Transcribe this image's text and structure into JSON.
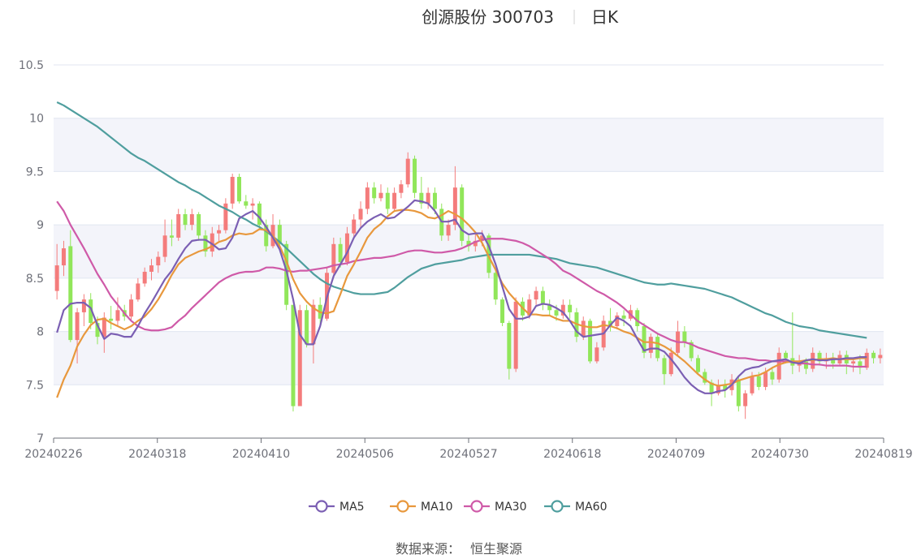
{
  "header": {
    "title": "创源股份 300703",
    "period": "日K"
  },
  "source": {
    "label": "数据来源：",
    "name": "恒生聚源"
  },
  "colors": {
    "up": "#f47c7c",
    "down": "#91e65a",
    "ma5": "#7b5fb3",
    "ma10": "#e8983d",
    "ma30": "#cf5aa8",
    "ma60": "#4f9e9e",
    "band": "#f3f4fa",
    "grid": "#e0e6f1",
    "axis": "#6e7079"
  },
  "chart_data": {
    "type": "candlestick",
    "y_axis": {
      "min": 7,
      "max": 10.5,
      "ticks": [
        "7",
        "7.5",
        "8",
        "8.5",
        "9",
        "9.5",
        "10",
        "10.5"
      ]
    },
    "x_axis": {
      "labels": [
        "20240226",
        "20240318",
        "20240410",
        "20240506",
        "20240527",
        "20240618",
        "20240709",
        "20240730",
        "20240819"
      ]
    },
    "legend": [
      {
        "key": "ma5",
        "label": "MA5"
      },
      {
        "key": "ma10",
        "label": "MA10"
      },
      {
        "key": "ma30",
        "label": "MA30"
      },
      {
        "key": "ma60",
        "label": "MA60"
      }
    ],
    "candles": [
      [
        8.38,
        8.62,
        8.3,
        8.82
      ],
      [
        8.62,
        8.78,
        8.52,
        8.85
      ],
      [
        8.8,
        7.92,
        7.9,
        8.95
      ],
      [
        7.92,
        8.18,
        7.7,
        8.22
      ],
      [
        8.18,
        8.3,
        8.05,
        8.35
      ],
      [
        8.3,
        8.08,
        8.02,
        8.36
      ],
      [
        8.08,
        7.95,
        7.88,
        8.14
      ],
      [
        7.95,
        8.13,
        7.8,
        8.18
      ],
      [
        8.12,
        8.1,
        8.02,
        8.24
      ],
      [
        8.1,
        8.2,
        8.05,
        8.32
      ],
      [
        8.2,
        8.14,
        8.1,
        8.25
      ],
      [
        8.14,
        8.3,
        8.1,
        8.35
      ],
      [
        8.3,
        8.45,
        8.28,
        8.5
      ],
      [
        8.45,
        8.56,
        8.42,
        8.6
      ],
      [
        8.56,
        8.62,
        8.48,
        8.68
      ],
      [
        8.62,
        8.7,
        8.55,
        8.75
      ],
      [
        8.7,
        8.9,
        8.65,
        9.05
      ],
      [
        8.9,
        8.88,
        8.8,
        9.05
      ],
      [
        8.88,
        9.1,
        8.85,
        9.15
      ],
      [
        9.1,
        9.0,
        8.95,
        9.15
      ],
      [
        9.0,
        9.1,
        8.95,
        9.15
      ],
      [
        9.1,
        8.9,
        8.85,
        9.12
      ],
      [
        8.9,
        8.75,
        8.7,
        8.95
      ],
      [
        8.75,
        8.92,
        8.7,
        8.98
      ],
      [
        8.92,
        8.95,
        8.85,
        9.0
      ],
      [
        8.95,
        9.2,
        8.92,
        9.25
      ],
      [
        9.2,
        9.45,
        9.15,
        9.48
      ],
      [
        9.45,
        9.22,
        9.2,
        9.48
      ],
      [
        9.22,
        9.18,
        9.15,
        9.28
      ],
      [
        9.18,
        9.2,
        9.05,
        9.25
      ],
      [
        9.2,
        9.0,
        8.95,
        9.22
      ],
      [
        9.0,
        8.8,
        8.75,
        9.05
      ],
      [
        8.8,
        9.0,
        8.78,
        9.1
      ],
      [
        9.0,
        8.82,
        8.78,
        9.05
      ],
      [
        8.82,
        8.25,
        8.2,
        8.85
      ],
      [
        8.25,
        7.3,
        7.25,
        8.2
      ],
      [
        7.3,
        8.2,
        7.32,
        8.25
      ],
      [
        8.2,
        7.88,
        7.85,
        8.25
      ],
      [
        7.88,
        8.25,
        7.7,
        8.3
      ],
      [
        8.25,
        8.12,
        8.05,
        8.32
      ],
      [
        8.12,
        8.55,
        8.1,
        8.6
      ],
      [
        8.55,
        8.82,
        8.5,
        8.88
      ],
      [
        8.82,
        8.65,
        8.6,
        8.88
      ],
      [
        8.65,
        8.92,
        8.62,
        8.98
      ],
      [
        8.92,
        9.05,
        8.88,
        9.1
      ],
      [
        9.05,
        9.15,
        8.98,
        9.22
      ],
      [
        9.15,
        9.35,
        9.1,
        9.4
      ],
      [
        9.35,
        9.25,
        9.2,
        9.4
      ],
      [
        9.25,
        9.3,
        9.22,
        9.38
      ],
      [
        9.3,
        9.15,
        9.1,
        9.35
      ],
      [
        9.15,
        9.3,
        9.12,
        9.35
      ],
      [
        9.3,
        9.38,
        9.25,
        9.42
      ],
      [
        9.38,
        9.62,
        9.35,
        9.68
      ],
      [
        9.62,
        9.3,
        9.25,
        9.65
      ],
      [
        9.3,
        9.2,
        9.15,
        9.45
      ],
      [
        9.2,
        9.3,
        9.15,
        9.35
      ],
      [
        9.3,
        9.15,
        9.1,
        9.35
      ],
      [
        9.15,
        8.9,
        8.85,
        9.2
      ],
      [
        8.9,
        9.0,
        8.85,
        9.05
      ],
      [
        9.0,
        9.35,
        8.95,
        9.55
      ],
      [
        9.35,
        8.85,
        8.8,
        9.38
      ],
      [
        8.85,
        8.8,
        8.75,
        8.9
      ],
      [
        8.8,
        8.85,
        8.75,
        8.92
      ],
      [
        8.85,
        8.9,
        8.8,
        8.95
      ],
      [
        8.9,
        8.55,
        8.5,
        8.92
      ],
      [
        8.55,
        8.3,
        8.25,
        8.58
      ],
      [
        8.3,
        8.08,
        8.05,
        8.32
      ],
      [
        8.08,
        7.65,
        7.55,
        8.1
      ],
      [
        7.65,
        8.28,
        7.62,
        8.32
      ],
      [
        8.28,
        8.15,
        8.1,
        8.32
      ],
      [
        8.15,
        8.3,
        8.12,
        8.35
      ],
      [
        8.3,
        8.38,
        8.25,
        8.42
      ],
      [
        8.38,
        8.25,
        8.2,
        8.42
      ],
      [
        8.25,
        8.2,
        8.15,
        8.3
      ],
      [
        8.2,
        8.15,
        8.1,
        8.25
      ],
      [
        8.15,
        8.25,
        8.12,
        8.3
      ],
      [
        8.25,
        8.18,
        8.12,
        8.3
      ],
      [
        8.18,
        7.95,
        7.9,
        8.22
      ],
      [
        7.95,
        8.1,
        7.92,
        8.14
      ],
      [
        8.1,
        7.72,
        7.7,
        8.12
      ],
      [
        7.72,
        7.85,
        7.7,
        7.9
      ],
      [
        7.85,
        8.1,
        7.82,
        8.15
      ],
      [
        8.1,
        8.05,
        8.0,
        8.22
      ],
      [
        8.05,
        8.15,
        8.02,
        8.18
      ],
      [
        8.15,
        8.12,
        8.05,
        8.2
      ],
      [
        8.12,
        8.2,
        8.1,
        8.25
      ],
      [
        8.2,
        8.05,
        8.0,
        8.22
      ],
      [
        8.05,
        7.8,
        7.75,
        8.08
      ],
      [
        7.8,
        7.95,
        7.75,
        7.98
      ],
      [
        7.95,
        7.75,
        7.72,
        7.98
      ],
      [
        7.75,
        7.6,
        7.5,
        7.78
      ],
      [
        7.6,
        7.8,
        7.58,
        7.85
      ],
      [
        7.8,
        8.0,
        7.78,
        8.1
      ],
      [
        8.0,
        7.9,
        7.85,
        8.05
      ],
      [
        7.9,
        7.75,
        7.72,
        7.92
      ],
      [
        7.75,
        7.62,
        7.6,
        7.78
      ],
      [
        7.62,
        7.52,
        7.5,
        7.65
      ],
      [
        7.52,
        7.42,
        7.3,
        7.55
      ],
      [
        7.42,
        7.5,
        7.4,
        7.55
      ],
      [
        7.5,
        7.45,
        7.38,
        7.55
      ],
      [
        7.45,
        7.55,
        7.4,
        7.6
      ],
      [
        7.55,
        7.3,
        7.25,
        7.58
      ],
      [
        7.3,
        7.42,
        7.18,
        7.45
      ],
      [
        7.42,
        7.58,
        7.4,
        7.62
      ],
      [
        7.58,
        7.48,
        7.45,
        7.62
      ],
      [
        7.48,
        7.62,
        7.45,
        7.66
      ],
      [
        7.62,
        7.55,
        7.5,
        7.65
      ],
      [
        7.55,
        7.8,
        7.52,
        7.85
      ],
      [
        7.8,
        7.75,
        7.7,
        7.82
      ],
      [
        7.75,
        7.68,
        7.6,
        8.18
      ],
      [
        7.68,
        7.72,
        7.62,
        7.78
      ],
      [
        7.72,
        7.65,
        7.6,
        7.75
      ],
      [
        7.65,
        7.8,
        7.62,
        7.85
      ],
      [
        7.8,
        7.72,
        7.68,
        7.82
      ],
      [
        7.72,
        7.75,
        7.65,
        7.8
      ],
      [
        7.75,
        7.7,
        7.65,
        7.8
      ],
      [
        7.7,
        7.78,
        7.68,
        7.82
      ],
      [
        7.78,
        7.7,
        7.6,
        7.82
      ],
      [
        7.7,
        7.72,
        7.62,
        7.75
      ],
      [
        7.72,
        7.66,
        7.6,
        7.78
      ],
      [
        7.66,
        7.8,
        7.64,
        7.84
      ],
      [
        7.8,
        7.75,
        7.7,
        7.82
      ],
      [
        7.75,
        7.78,
        7.7,
        7.84
      ]
    ],
    "ma": {
      "ma5": [
        7.99,
        8.2,
        8.26,
        8.27,
        8.27,
        8.22,
        8.06,
        7.93,
        7.98,
        7.97,
        7.95,
        7.95,
        8.05,
        8.17,
        8.27,
        8.38,
        8.49,
        8.57,
        8.68,
        8.78,
        8.85,
        8.86,
        8.86,
        8.82,
        8.77,
        8.78,
        8.88,
        9.06,
        9.1,
        9.13,
        9.07,
        8.98,
        8.88,
        8.77,
        8.57,
        8.3,
        7.97,
        7.88,
        7.88,
        8.05,
        8.32,
        8.52,
        8.63,
        8.74,
        8.88,
        8.97,
        9.03,
        9.07,
        9.1,
        9.06,
        9.07,
        9.12,
        9.17,
        9.23,
        9.22,
        9.2,
        9.13,
        9.03,
        9.03,
        9.05,
        8.95,
        8.91,
        8.92,
        8.92,
        8.8,
        8.63,
        8.42,
        8.21,
        8.12,
        8.12,
        8.14,
        8.24,
        8.26,
        8.25,
        8.22,
        8.18,
        8.1,
        8.0,
        7.95,
        7.96,
        7.97,
        7.98,
        8.06,
        8.13,
        8.1,
        8.05,
        7.93,
        7.82,
        7.84,
        7.84,
        7.81,
        7.74,
        7.66,
        7.57,
        7.5,
        7.45,
        7.42,
        7.42,
        7.44,
        7.45,
        7.5,
        7.58,
        7.64,
        7.66,
        7.67,
        7.7,
        7.72,
        7.73,
        7.74,
        7.71,
        7.7,
        7.73,
        7.74,
        7.73,
        7.73,
        7.74,
        7.74,
        7.75,
        7.75,
        7.76,
        7.76
      ],
      "ma10": [
        7.38,
        7.55,
        7.68,
        7.86,
        7.97,
        8.06,
        8.11,
        8.12,
        8.08,
        8.05,
        8.02,
        8.05,
        8.1,
        8.14,
        8.21,
        8.3,
        8.41,
        8.53,
        8.63,
        8.69,
        8.72,
        8.75,
        8.77,
        8.8,
        8.84,
        8.86,
        8.9,
        8.92,
        8.91,
        8.92,
        8.96,
        8.95,
        8.9,
        8.8,
        8.66,
        8.49,
        8.36,
        8.28,
        8.22,
        8.18,
        8.17,
        8.19,
        8.35,
        8.52,
        8.63,
        8.75,
        8.88,
        8.96,
        9.01,
        9.08,
        9.13,
        9.14,
        9.14,
        9.13,
        9.11,
        9.07,
        9.06,
        9.09,
        9.13,
        9.1,
        9.06,
        9.0,
        8.93,
        8.83,
        8.7,
        8.58,
        8.45,
        8.36,
        8.29,
        8.22,
        8.16,
        8.16,
        8.15,
        8.15,
        8.12,
        8.1,
        8.1,
        8.07,
        8.05,
        8.04,
        8.04,
        8.06,
        8.05,
        8.03,
        8.0,
        7.98,
        7.94,
        7.9,
        7.9,
        7.89,
        7.86,
        7.82,
        7.77,
        7.72,
        7.66,
        7.6,
        7.55,
        7.51,
        7.49,
        7.5,
        7.51,
        7.54,
        7.56,
        7.58,
        7.59,
        7.62,
        7.66,
        7.69,
        7.71,
        7.72,
        7.72,
        7.73,
        7.73,
        7.74,
        7.74,
        7.75,
        7.74,
        7.74,
        7.74,
        7.75,
        7.75
      ],
      "ma30": [
        9.22,
        9.13,
        9.0,
        8.89,
        8.78,
        8.66,
        8.54,
        8.44,
        8.33,
        8.25,
        8.17,
        8.1,
        8.05,
        8.02,
        8.01,
        8.01,
        8.02,
        8.04,
        8.1,
        8.15,
        8.22,
        8.28,
        8.34,
        8.4,
        8.46,
        8.5,
        8.53,
        8.55,
        8.56,
        8.56,
        8.57,
        8.6,
        8.6,
        8.59,
        8.57,
        8.56,
        8.57,
        8.57,
        8.58,
        8.59,
        8.6,
        8.62,
        8.63,
        8.64,
        8.66,
        8.67,
        8.68,
        8.69,
        8.69,
        8.7,
        8.71,
        8.73,
        8.75,
        8.76,
        8.76,
        8.75,
        8.74,
        8.74,
        8.75,
        8.76,
        8.78,
        8.81,
        8.84,
        8.86,
        8.87,
        8.87,
        8.87,
        8.86,
        8.85,
        8.83,
        8.8,
        8.76,
        8.72,
        8.68,
        8.63,
        8.57,
        8.54,
        8.5,
        8.46,
        8.42,
        8.38,
        8.35,
        8.31,
        8.27,
        8.22,
        8.16,
        8.1,
        8.06,
        8.02,
        7.98,
        7.95,
        7.92,
        7.9,
        7.9,
        7.88,
        7.85,
        7.83,
        7.81,
        7.79,
        7.77,
        7.76,
        7.75,
        7.75,
        7.74,
        7.73,
        7.73,
        7.72,
        7.72,
        7.72,
        7.71,
        7.7,
        7.7,
        7.69,
        7.69,
        7.68,
        7.68,
        7.68,
        7.68,
        7.67,
        7.67,
        7.67
      ],
      "ma60": [
        10.15,
        10.12,
        10.08,
        10.04,
        10.0,
        9.96,
        9.92,
        9.87,
        9.82,
        9.77,
        9.72,
        9.67,
        9.63,
        9.6,
        9.56,
        9.52,
        9.48,
        9.44,
        9.4,
        9.37,
        9.33,
        9.3,
        9.26,
        9.22,
        9.18,
        9.15,
        9.12,
        9.08,
        9.05,
        9.01,
        8.98,
        8.94,
        8.89,
        8.84,
        8.78,
        8.72,
        8.66,
        8.6,
        8.54,
        8.49,
        8.45,
        8.42,
        8.4,
        8.38,
        8.36,
        8.35,
        8.35,
        8.35,
        8.36,
        8.37,
        8.41,
        8.46,
        8.51,
        8.55,
        8.59,
        8.61,
        8.63,
        8.64,
        8.65,
        8.66,
        8.67,
        8.69,
        8.7,
        8.71,
        8.72,
        8.72,
        8.72,
        8.72,
        8.72,
        8.72,
        8.72,
        8.71,
        8.7,
        8.69,
        8.68,
        8.66,
        8.64,
        8.63,
        8.62,
        8.61,
        8.6,
        8.58,
        8.56,
        8.54,
        8.52,
        8.5,
        8.48,
        8.46,
        8.45,
        8.44,
        8.44,
        8.45,
        8.44,
        8.43,
        8.42,
        8.41,
        8.4,
        8.38,
        8.36,
        8.34,
        8.32,
        8.29,
        8.26,
        8.23,
        8.2,
        8.17,
        8.15,
        8.12,
        8.09,
        8.07,
        8.05,
        8.04,
        8.03,
        8.01,
        8.0,
        7.99,
        7.98,
        7.97,
        7.96,
        7.95,
        7.94
      ]
    }
  }
}
